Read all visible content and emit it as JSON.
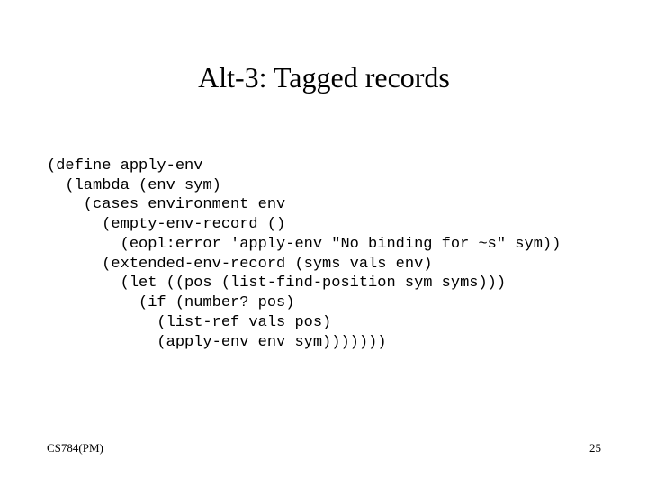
{
  "title": "Alt-3: Tagged records",
  "code": {
    "l1": "(define apply-env",
    "l2": "  (lambda (env sym)",
    "l3": "    (cases environment env",
    "l4": "      (empty-env-record ()",
    "l5": "        (eopl:error 'apply-env \"No binding for ~s\" sym))",
    "l6": "      (extended-env-record (syms vals env)",
    "l7": "        (let ((pos (list-find-position sym syms)))",
    "l8": "          (if (number? pos)",
    "l9": "            (list-ref vals pos)",
    "l10": "            (apply-env env sym)))))))"
  },
  "footer": {
    "left": "CS784(PM)",
    "right": "25"
  }
}
